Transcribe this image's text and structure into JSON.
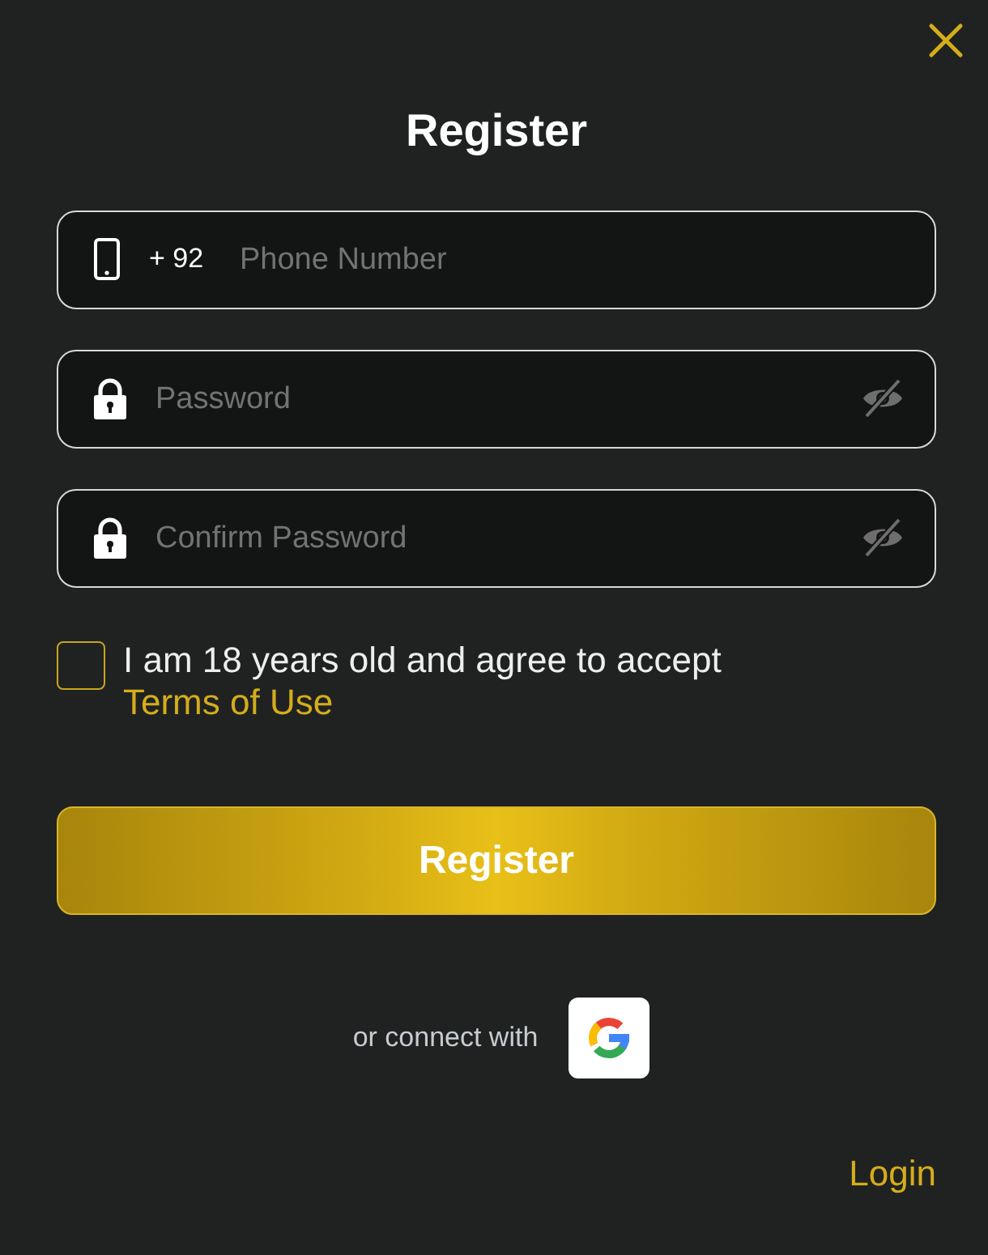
{
  "dialog": {
    "title": "Register"
  },
  "fields": [
    {
      "kind": "phone",
      "prefix": "+ 92",
      "placeholder": "Phone Number"
    },
    {
      "kind": "password",
      "placeholder": "Password"
    },
    {
      "kind": "password",
      "placeholder": "Confirm Password"
    }
  ],
  "agreement": {
    "checked": false,
    "text": "I am 18 years old and agree to accept ",
    "link": "Terms of Use"
  },
  "submit": "Register",
  "social": {
    "label": "or connect with"
  },
  "login_link": "Login"
}
